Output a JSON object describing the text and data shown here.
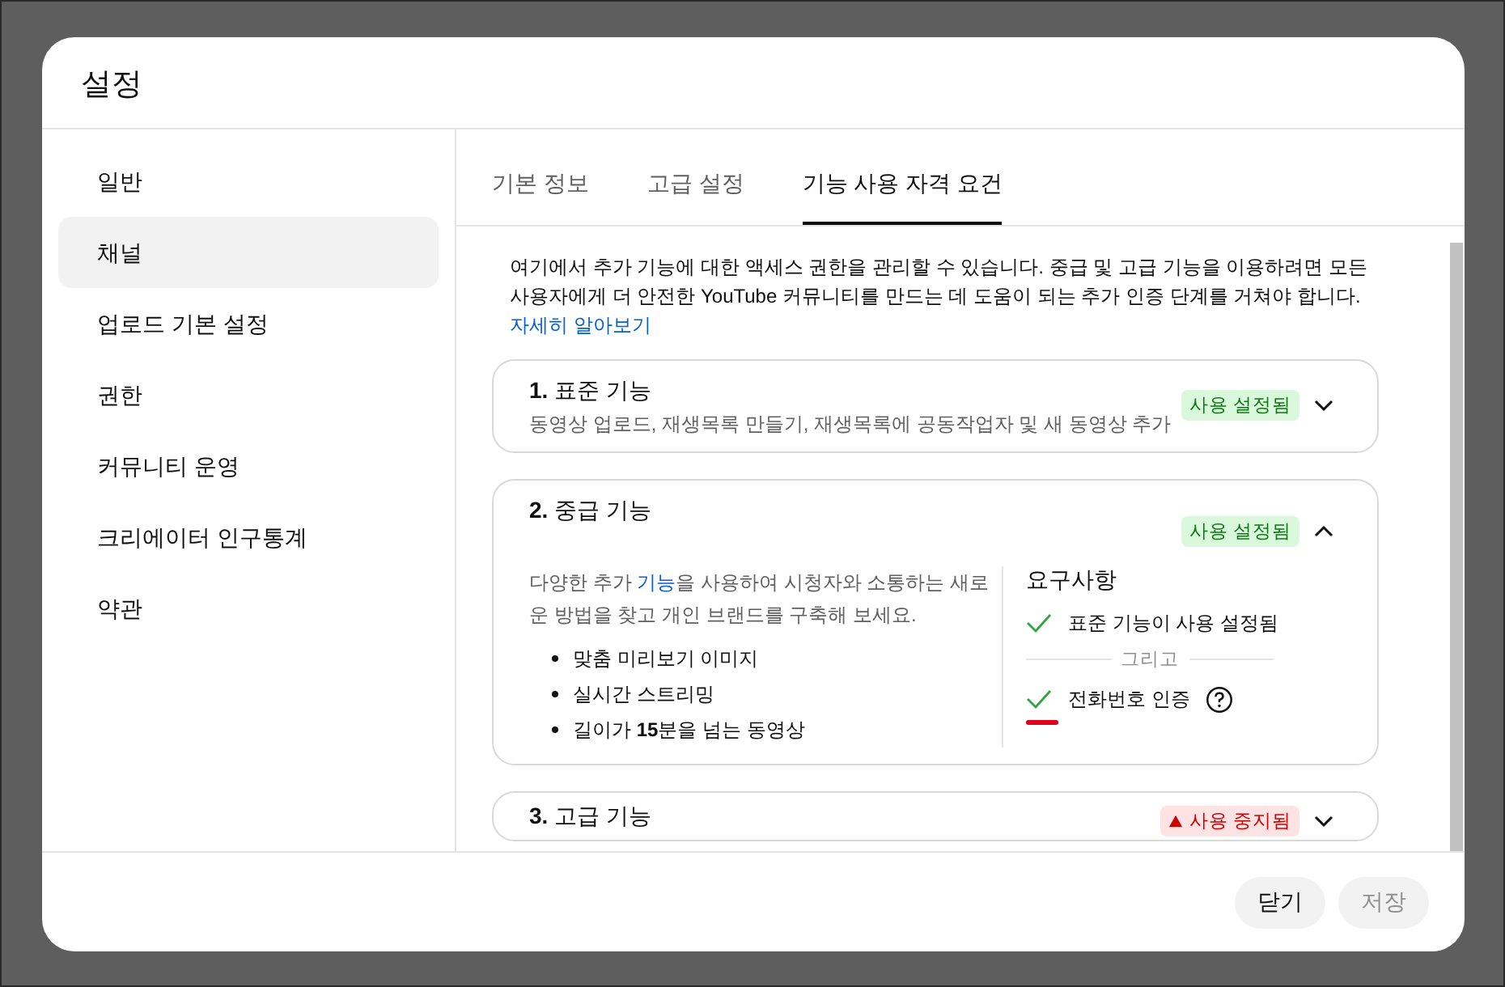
{
  "dialog": {
    "title": "설정"
  },
  "sidebar": {
    "items": [
      {
        "label": "일반",
        "selected": false
      },
      {
        "label": "채널",
        "selected": true
      },
      {
        "label": "업로드 기본 설정",
        "selected": false
      },
      {
        "label": "권한",
        "selected": false
      },
      {
        "label": "커뮤니티 운영",
        "selected": false
      },
      {
        "label": "크리에이터 인구통계",
        "selected": false
      },
      {
        "label": "약관",
        "selected": false
      }
    ]
  },
  "tabs": [
    {
      "label": "기본 정보",
      "selected": false
    },
    {
      "label": "고급 설정",
      "selected": false
    },
    {
      "label": "기능 사용 자격 요건",
      "selected": true
    }
  ],
  "intro": {
    "text": "여기에서 추가 기능에 대한 액세스 권한을 관리할 수 있습니다. 중급 및 고급 기능을 이용하려면 모든 사용자에게 더 안전한 YouTube 커뮤니티를 만드는 데 도움이 되는 추가 인증 단계를 거쳐야 합니다.",
    "link": "자세히 알아보기"
  },
  "features": [
    {
      "title": "**1.** 표준 기능",
      "description": "동영상 업로드, 재생목록 만들기, 재생목록에 공동작업자 및 새 동영상 추가",
      "badge": "사용 설정됨",
      "kind": "enabled",
      "expanded": false
    },
    {
      "title": "**2.** 중급 기능",
      "badge": "사용 설정됨",
      "kind": "enabled",
      "expanded": true,
      "details": {
        "text_before": "다양한 추가 ",
        "link": "기능",
        "text_after": "을 사용하여 시청자와 소통하는 새로운 방법을 찾고 개인 브랜드를 구축해 보세요.",
        "bullets": [
          "맞춤 미리보기 이미지",
          "실시간 스트리밍",
          "길이가 **15**분을 넘는 동영상"
        ],
        "requirements_title": "요구사항",
        "separator": "그리고",
        "requirements": [
          {
            "label": "표준 기능이 사용 설정됨",
            "met": true,
            "help": false
          },
          {
            "label": "전화번호 인증",
            "met": true,
            "help": true
          }
        ]
      }
    },
    {
      "title": "**3.** 고급 기능",
      "badge": "사용 중지됨",
      "kind": "disabled",
      "expanded": false
    }
  ],
  "footer": {
    "buttons": [
      {
        "label": "닫기",
        "disabled": false
      },
      {
        "label": "저장",
        "disabled": true
      }
    ]
  }
}
